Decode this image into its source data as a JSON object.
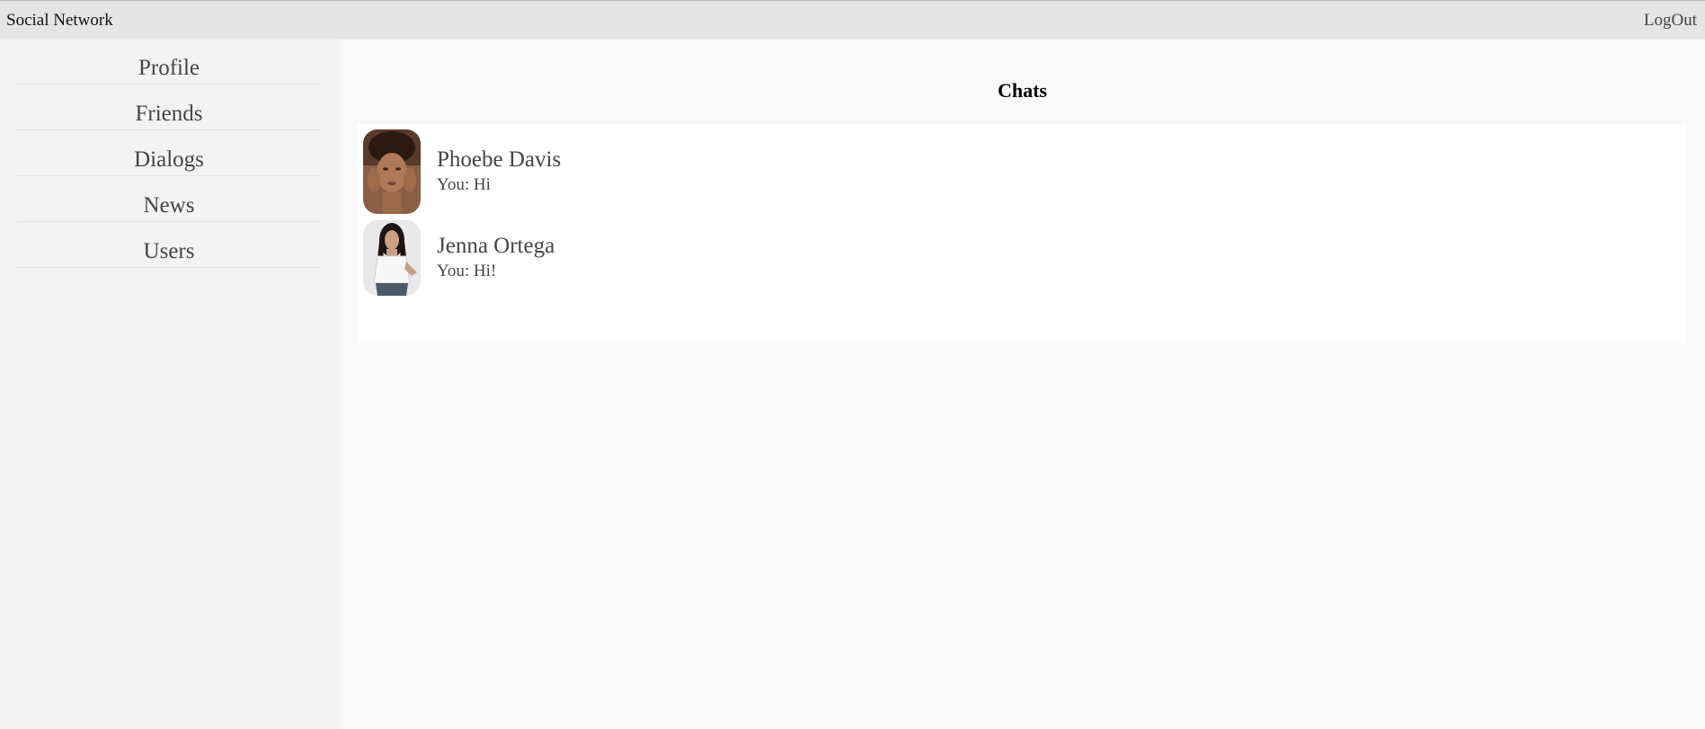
{
  "header": {
    "brand": "Social Network",
    "logout_label": "LogOut"
  },
  "sidebar": {
    "items": [
      {
        "label": "Profile"
      },
      {
        "label": "Friends"
      },
      {
        "label": "Dialogs"
      },
      {
        "label": "News"
      },
      {
        "label": "Users"
      }
    ]
  },
  "main": {
    "title": "Chats",
    "chats": [
      {
        "name": "Phoebe Davis",
        "last_message": "You: Hi"
      },
      {
        "name": "Jenna Ortega",
        "last_message": "You: Hi!"
      }
    ]
  },
  "colors": {
    "topbar": "#e5e5e5",
    "sidebar": "#f3f3f3",
    "content": "#f9f9f9",
    "panel": "#ffffff",
    "text_muted": "#444444"
  }
}
